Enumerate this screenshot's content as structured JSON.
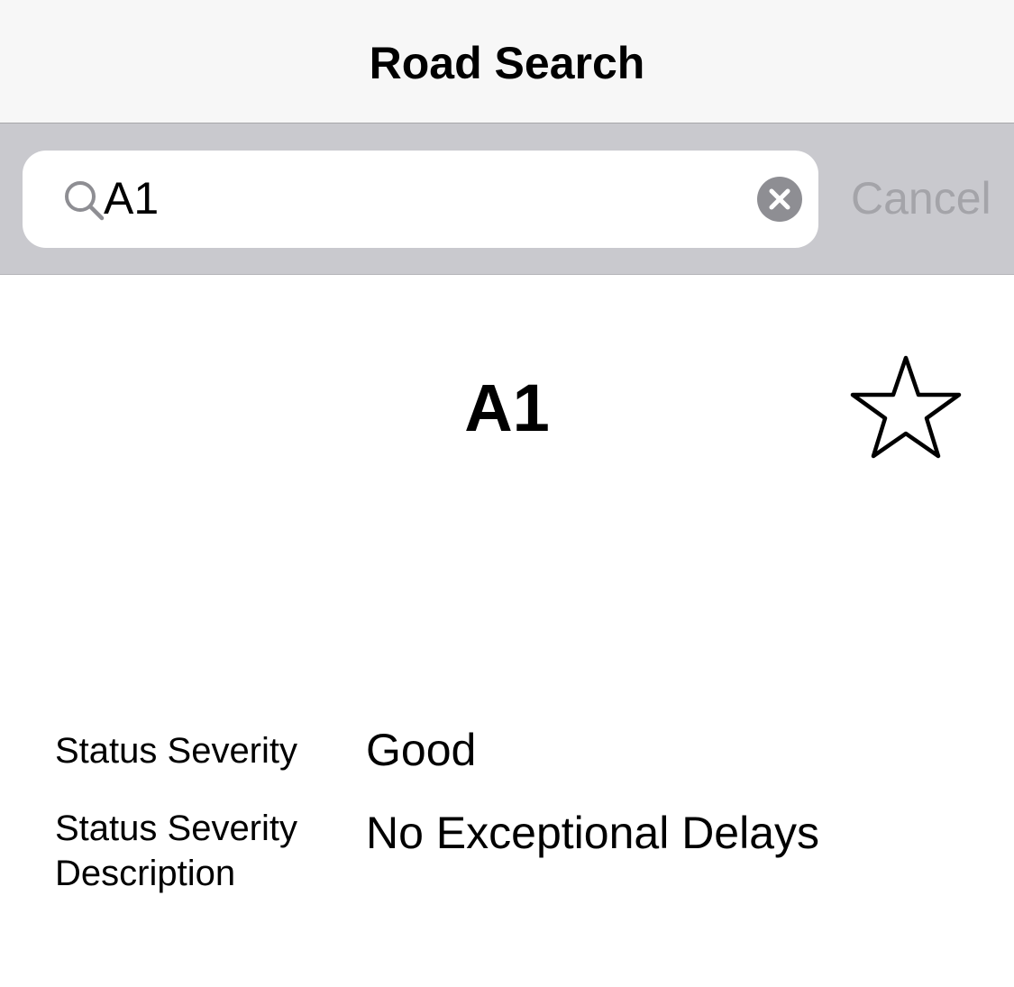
{
  "nav": {
    "title": "Road Search"
  },
  "search": {
    "value": "A1",
    "cancel_label": "Cancel",
    "icon": "search-icon",
    "clear_icon": "clear-circle-icon"
  },
  "road": {
    "name": "A1",
    "favorite_icon": "star-outline-icon"
  },
  "details": {
    "severity_label": "Status Severity",
    "severity_value": "Good",
    "description_label_line1": "Status Severity",
    "description_label_line2": "Description",
    "description_value": "No Exceptional Delays"
  },
  "colors": {
    "nav_background": "#f7f7f7",
    "search_bar_background": "#c9c9ce",
    "cancel_text": "#a4a4a9",
    "clear_button": "#8e8e93"
  }
}
